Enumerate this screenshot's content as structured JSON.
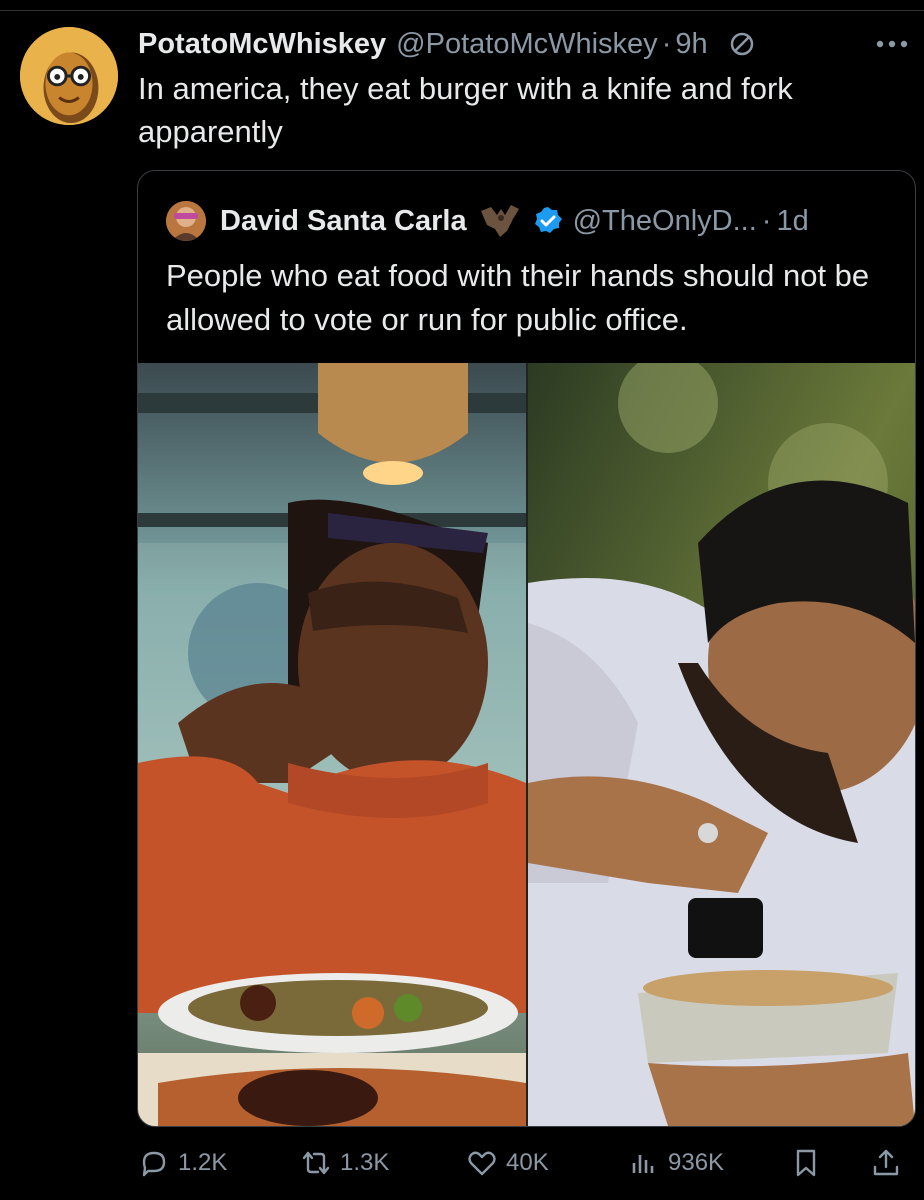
{
  "tweet": {
    "display_name": "PotatoMcWhiskey",
    "handle": "@PotatoMcWhiskey",
    "separator": "·",
    "time": "9h",
    "text": "In america, they eat burger with a knife and fork apparently"
  },
  "quote": {
    "display_name": "David Santa Carla",
    "handle": "@TheOnlyD...",
    "separator": "·",
    "time": "1d",
    "text": "People who eat food with their hands should not be allowed to vote or run for public office."
  },
  "actions": {
    "replies": "1.2K",
    "reposts": "1.3K",
    "likes": "40K",
    "views": "936K"
  },
  "colors": {
    "background": "#000000",
    "text": "#e7e9ea",
    "muted": "#8b98a5",
    "verified": "#1d9bf0",
    "border": "#3a3f44"
  },
  "icons": [
    "potato-avatar",
    "no-sign-icon",
    "more-icon",
    "bat-icon",
    "verified-icon",
    "reply-icon",
    "repost-icon",
    "like-icon",
    "views-icon",
    "bookmark-icon",
    "share-icon"
  ]
}
